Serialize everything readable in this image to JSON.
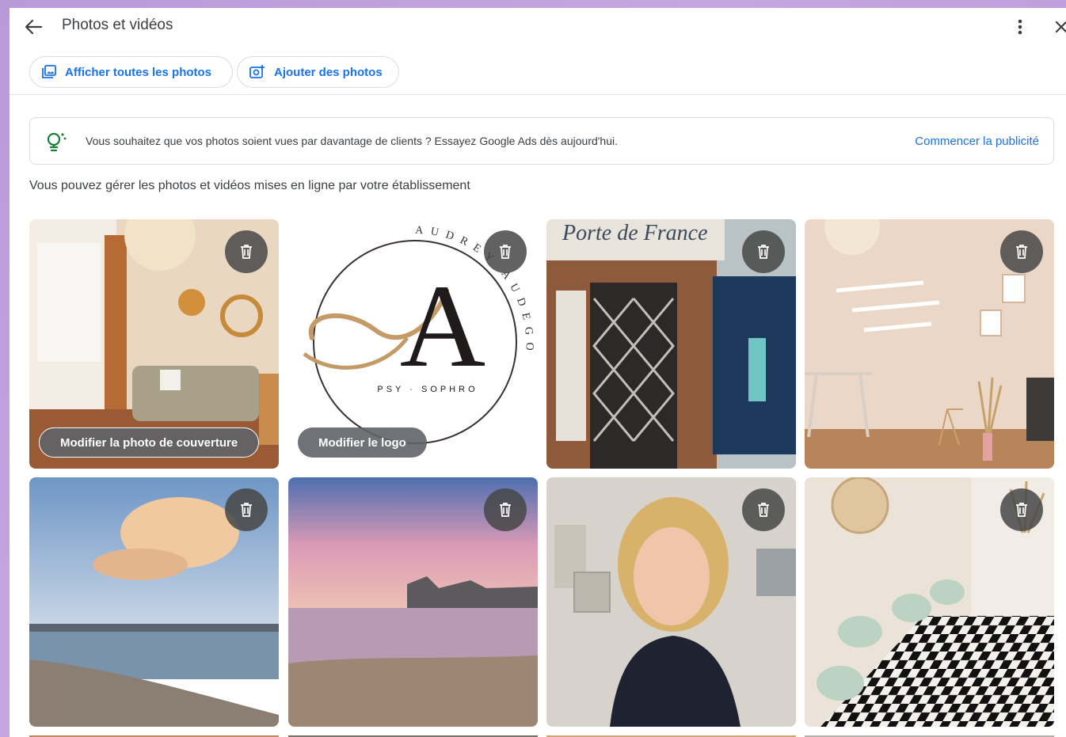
{
  "header": {
    "title": "Photos et vidéos",
    "back_icon": "arrow-left-icon",
    "more_icon": "more-vert-icon",
    "close_icon": "close-icon"
  },
  "actions": {
    "view_all_label": "Afficher toutes les photos",
    "add_label": "Ajouter des photos"
  },
  "banner": {
    "icon": "lightbulb-icon",
    "text": "Vous souhaitez que vos photos soient vues par davantage de clients ? Essayez Google Ads dès aujourd'hui.",
    "link": "Commencer la publicité"
  },
  "subtitle": "Vous pouvez gérer les photos et vidéos mises en ligne par votre établissement",
  "logo": {
    "monogram": "A",
    "arc_text": "AUDREY AUDEGOND",
    "tagline": "PSY · SOPHRO"
  },
  "storefront_sign": "Porte de France",
  "tiles": [
    {
      "name": "living-room-photo",
      "badge": "Modifier la photo de couverture"
    },
    {
      "name": "logo-image",
      "badge": "Modifier le logo"
    },
    {
      "name": "storefront-photo"
    },
    {
      "name": "office-shelves-photo"
    },
    {
      "name": "seaside-town-photo"
    },
    {
      "name": "sunset-harbor-photo"
    },
    {
      "name": "portrait-photo"
    },
    {
      "name": "waiting-room-photo"
    }
  ],
  "colors": {
    "accent": "#1a73e8",
    "text": "#3c4043",
    "lightbulb": "#188038",
    "overlay": "#5f6368"
  }
}
